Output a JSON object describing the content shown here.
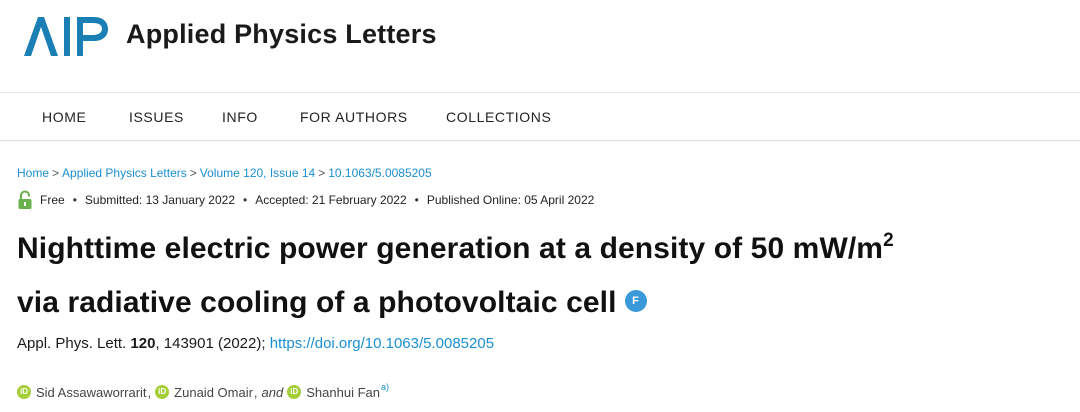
{
  "header": {
    "logo_text": "AIP",
    "journal_name": "Applied Physics Letters",
    "brand_color": "#1a7fb5"
  },
  "nav": {
    "items": [
      {
        "label": "HOME"
      },
      {
        "label": "ISSUES"
      },
      {
        "label": "INFO"
      },
      {
        "label": "FOR AUTHORS"
      },
      {
        "label": "COLLECTIONS"
      }
    ]
  },
  "breadcrumb": {
    "items": [
      "Home",
      "Applied Physics Letters",
      "Volume 120, Issue 14",
      "10.1063/5.0085205"
    ],
    "separator": ">"
  },
  "meta": {
    "access": "Free",
    "access_icon": "unlocked-lock-icon",
    "submitted": "Submitted: 13 January 2022",
    "accepted": "Accepted: 21 February 2022",
    "published": "Published Online: 05 April 2022",
    "bullet": "•"
  },
  "article": {
    "title_line1": "Nighttime electric power generation at a density of 50 mW/m",
    "title_sup": "2",
    "title_line2": "via radiative cooling of a photovoltaic cell",
    "badge": "F",
    "badge_color": "#3a9ad9"
  },
  "citation": {
    "journal": "Appl. Phys. Lett.",
    "volume": "120",
    "rest": ", 143901 (2022);",
    "doi": "https://doi.org/10.1063/5.0085205"
  },
  "authors": {
    "list": [
      "Sid Assawaworrarit",
      "Zunaid Omair",
      "Shanhui Fan"
    ],
    "separator": ",",
    "and_word": "and",
    "affiliation_mark": "a)",
    "orcid_icon": "orcid-icon",
    "orcid_color": "#a6ce39"
  }
}
